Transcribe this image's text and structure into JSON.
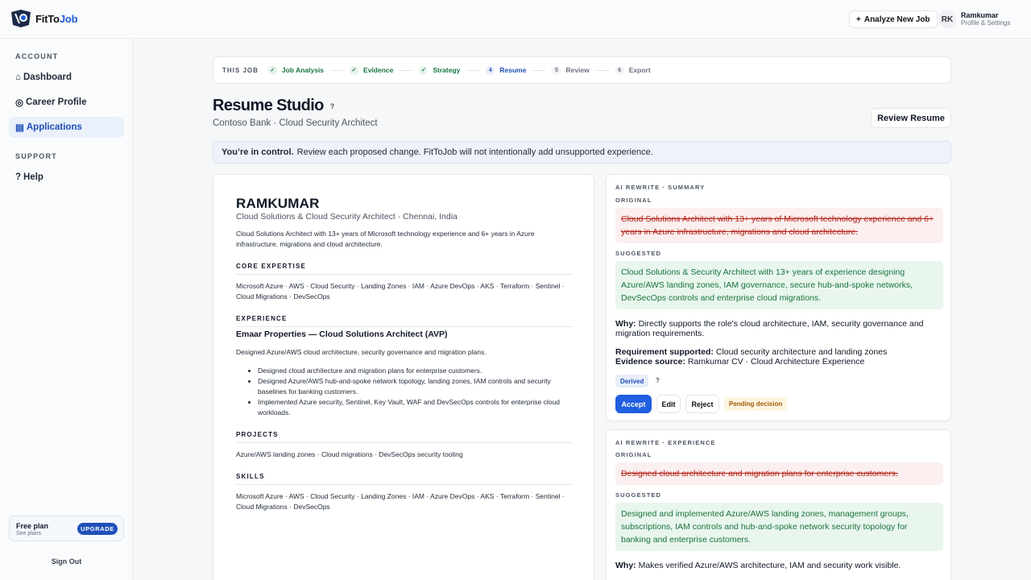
{
  "app": {
    "logo_prefix": "FitTo",
    "logo_suffix": "Job",
    "analyze_label": "Analyze New Job",
    "user_initials": "RK",
    "user_name": "Ramkumar",
    "user_sub": "Profile & Settings"
  },
  "sidebar": {
    "account_heading": "ACCOUNT",
    "items": [
      {
        "icon": "⌂",
        "label": "Dashboard"
      },
      {
        "icon": "◎",
        "label": "Career Profile"
      },
      {
        "icon": "▤",
        "label": "Applications"
      }
    ],
    "support_heading": "SUPPORT",
    "help_icon": "?",
    "help_label": "Help",
    "plan_title": "Free plan",
    "plan_sub": "See plans",
    "upgrade_label": "UPGRADE",
    "signout_label": "Sign Out"
  },
  "stepper": {
    "label": "THIS JOB",
    "steps": [
      {
        "mark": "✓",
        "label": "Job Analysis",
        "state": "done"
      },
      {
        "mark": "✓",
        "label": "Evidence",
        "state": "done"
      },
      {
        "mark": "✓",
        "label": "Strategy",
        "state": "done"
      },
      {
        "mark": "4",
        "label": "Resume",
        "state": "current"
      },
      {
        "mark": "5",
        "label": "Review",
        "state": "todo"
      },
      {
        "mark": "6",
        "label": "Export",
        "state": "todo"
      }
    ]
  },
  "page": {
    "title": "Resume Studio",
    "title_help": "?",
    "subtitle": "Contoso Bank · Cloud Security Architect",
    "review_button": "Review Resume",
    "banner_bold": "You’re in control.",
    "banner_text": "Review each proposed change. FitToJob will not intentionally add unsupported experience."
  },
  "resume": {
    "name": "RAMKUMAR",
    "headline": "Cloud Solutions & Cloud Security Architect · Chennai, India",
    "summary": "Cloud Solutions Architect with 13+ years of Microsoft technology experience and 6+ years in Azure infrastructure, migrations and cloud architecture.",
    "core_heading": "CORE EXPERTISE",
    "core_text": "Microsoft Azure · AWS · Cloud Security · Landing Zones · IAM · Azure DevOps · AKS · Terraform · Sentinel · Cloud Migrations · DevSecOps",
    "experience_heading": "EXPERIENCE",
    "job_title": "Emaar Properties — Cloud Solutions Architect (AVP)",
    "job_summary": "Designed Azure/AWS cloud architecture, security governance and migration plans.",
    "bullets": [
      "Designed cloud architecture and migration plans for enterprise customers.",
      "Designed Azure/AWS hub-and-spoke network topology, landing zones, IAM controls and security baselines for banking customers.",
      "Implemented Azure security, Sentinel, Key Vault, WAF and DevSecOps controls for enterprise cloud workloads."
    ],
    "projects_heading": "PROJECTS",
    "projects_text": "Azure/AWS landing zones · Cloud migrations · DevSecOps security tooling",
    "skills_heading": "SKILLS",
    "skills_text": "Microsoft Azure · AWS · Cloud Security · Landing Zones · IAM · Azure DevOps · AKS · Terraform · Sentinel · Cloud Migrations · DevSecOps"
  },
  "card1": {
    "heading": "AI REWRITE · SUMMARY",
    "original_label": "ORIGINAL",
    "original": "Cloud Solutions Architect with 13+ years of Microsoft technology experience and 6+ years in Azure infrastructure, migrations and cloud architecture.",
    "suggested_label": "SUGGESTED",
    "suggested": "Cloud Solutions & Security Architect with 13+ years of experience designing Azure/AWS landing zones, IAM governance, secure hub-and-spoke networks, DevSecOps controls and enterprise cloud migrations.",
    "why_label": "Why:",
    "why": "Directly supports the role's cloud architecture, IAM, security governance and migration requirements.",
    "req_label": "Requirement supported:",
    "req": "Cloud security architecture and landing zones",
    "evidence_label": "Evidence source:",
    "evidence": "Ramkumar CV · Cloud Architecture Experience",
    "badge": "Derived",
    "badge_help": "?",
    "accept": "Accept",
    "edit": "Edit",
    "reject": "Reject",
    "status": "Pending decision"
  },
  "card2": {
    "heading": "AI REWRITE · EXPERIENCE",
    "original_label": "ORIGINAL",
    "original": "Designed cloud architecture and migration plans for enterprise customers.",
    "suggested_label": "SUGGESTED",
    "suggested": "Designed and implemented Azure/AWS landing zones, management groups, subscriptions, IAM controls and hub-and-spoke network security topology for banking and enterprise customers.",
    "why_label": "Why:",
    "why": "Makes verified Azure/AWS architecture, IAM and security work visible."
  }
}
